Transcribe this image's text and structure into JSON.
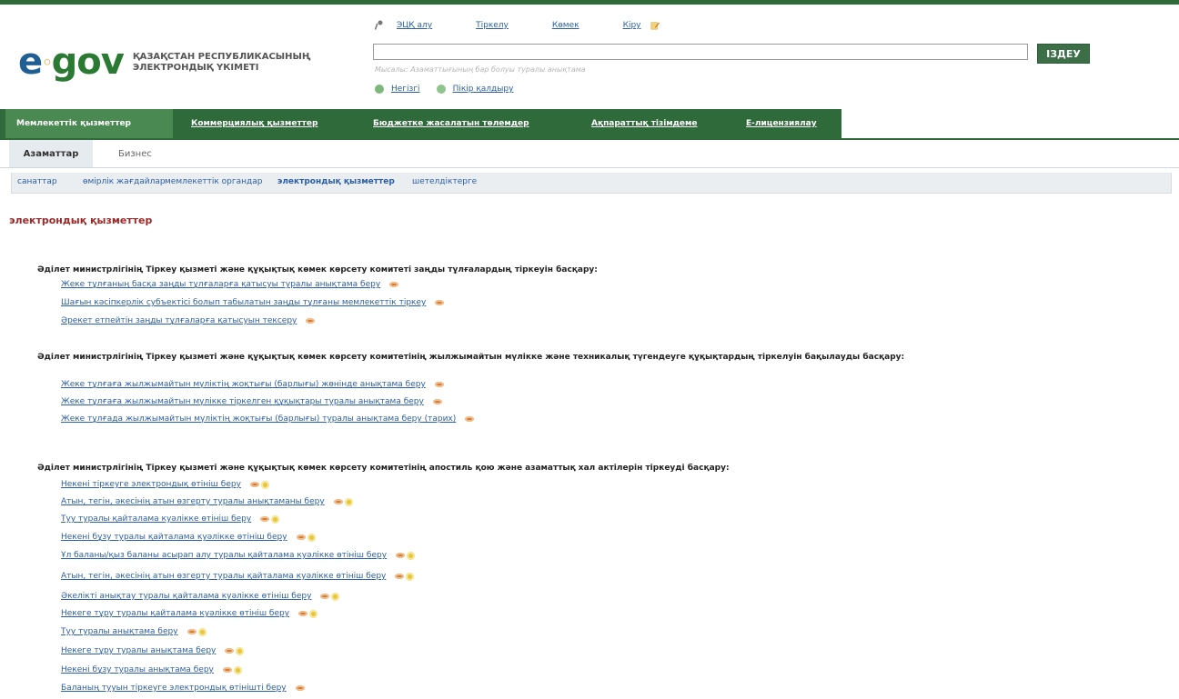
{
  "header": {
    "logo_text": "e",
    "logo_text2": "gov",
    "logo_line1": "ҚАЗАҚСТАН РЕСПУБЛИКАСЫНЫҢ",
    "logo_line2": "ЭЛЕКТРОНДЫҚ ҮКІМЕТІ",
    "top_links": [
      "ЭЦҚ алу",
      "Тіркелу",
      "Көмек",
      "Кіру"
    ],
    "search_placeholder": "",
    "search_button": "ІЗДЕУ",
    "search_hint": "Мысалы: Азаматтығының бар болуы туралы анықтама",
    "sub_links": [
      "Негізгі",
      "Пікір қалдыру"
    ]
  },
  "nav": {
    "items": [
      "Мемлекеттік қызметтер",
      "Коммерциялық қызметтер",
      "Бюджетке жасалатын төлемдер",
      "Ақпараттық тізімдеме",
      "Е-лицензиялау"
    ]
  },
  "tabs": [
    "Азаматтар",
    "Бизнес"
  ],
  "crumbs": [
    "санаттар",
    "өмірлік жағдайлар",
    "мемлекеттік органдар",
    "электрондық қызметтер",
    "шетелдіктерге"
  ],
  "main": {
    "section_title": "электрондық қызметтер",
    "groups": [
      {
        "title": "Әділет министрлігінің Тіркеу қызметі және құқықтық көмек көрсету комитеті заңды тұлғалардың тіркеуін басқару:",
        "items": [
          "Жеке тұлғаның басқа заңды тұлғаларға қатысуы туралы анықтама беру",
          "Шағын кәсіпкерлік субъектісі болып табылатын заңды тұлғаны мемлекеттік тіркеу",
          "Әрекет етпейтін заңды тұлғаларға қатысуын тексеру"
        ]
      },
      {
        "title": "Әділет министрлігінің Тіркеу қызметі және құқықтық көмек көрсету комитетінің жылжымайтын мүлікке және техникалық түгендеуге құқықтардың тіркелуін бақылауды басқару:",
        "items": [
          "Жеке тұлғаға жылжымайтын мүліктің жоқтығы (барлығы) жөнінде анықтама беру",
          "Жеке тұлғаға жылжымайтын мүлікке тіркелген құқықтары туралы анықтама беру",
          "Жеке тұлғада жылжымайтын мүліктің жоқтығы (барлығы) туралы анықтама беру (тарих)"
        ]
      },
      {
        "title": "Әділет министрлігінің Тіркеу қызметі және құқықтық көмек көрсету комитетінің апостиль қою және азаматтық хал актілерін тіркеуді басқару:",
        "items": [
          "Некені тіркеуге электрондық өтініш беру",
          "Атын, тегін, әкесінің атын өзгерту туралы анықтаманы беру",
          "Туу туралы қайталама куәлікке өтініш беру",
          "Некені бұзу туралы қайталама куәлікке өтініш беру",
          "Ұл баланы/қыз баланы асырап алу туралы қайталама куәлікке өтініш беру",
          "Атын, тегін, әкесінің атын өзгерту туралы қайталама куәлікке өтініш беру",
          "Әкелікті анықтау туралы қайталама куәлікке өтініш беру",
          "Некеге тұру туралы қайталама куәлікке өтініш беру",
          "Туу туралы анықтама беру",
          "Некеге тұру туралы анықтама беру",
          "Некені бұзу туралы анықтама беру",
          "Баланың тууын тіркеуге электрондық өтінішті беру"
        ]
      }
    ]
  }
}
